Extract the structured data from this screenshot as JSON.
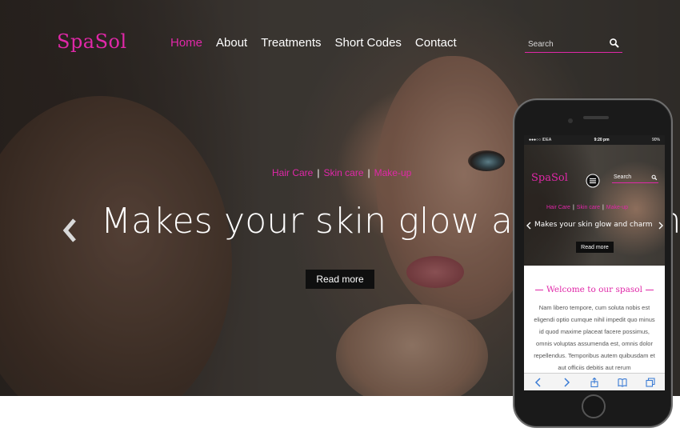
{
  "brand": {
    "logo": "SpaSol",
    "accent": "#e028a8"
  },
  "nav": {
    "items": [
      {
        "label": "Home",
        "active": true
      },
      {
        "label": "About",
        "active": false
      },
      {
        "label": "Treatments",
        "active": false
      },
      {
        "label": "Short Codes",
        "active": false
      },
      {
        "label": "Contact",
        "active": false
      }
    ]
  },
  "search": {
    "placeholder": "Search",
    "icon": "search-icon"
  },
  "slide": {
    "tags": [
      "Hair Care",
      "Skin care",
      "Make-up"
    ],
    "separator": "|",
    "headline": "Makes your skin glow and charm",
    "button": "Read more",
    "prev_icon": "chevron-left-icon"
  },
  "phone": {
    "status": {
      "carrier": "●●●○○ IDEA",
      "time": "9:20 pm",
      "battery": "90%"
    },
    "logo": "SpaSol",
    "menu_icon": "hamburger-icon",
    "search_label": "Search",
    "tags": [
      "Hair Care",
      "Skin care",
      "Make-up"
    ],
    "separator": "|",
    "headline": "Makes your skin glow and charm",
    "button": "Read more",
    "welcome": "Welcome to our spasol",
    "body": "Nam libero tempore, cum soluta nobis est eligendi optio cumque nihil impedit quo minus id quod maxime placeat facere possimus, omnis voluptas assumenda est, omnis dolor repellendus. Temporibus autem quibusdam et aut officiis debitis aut rerum",
    "toolbar": [
      "back-icon",
      "forward-icon",
      "share-icon",
      "bookmarks-icon",
      "tabs-icon"
    ]
  }
}
